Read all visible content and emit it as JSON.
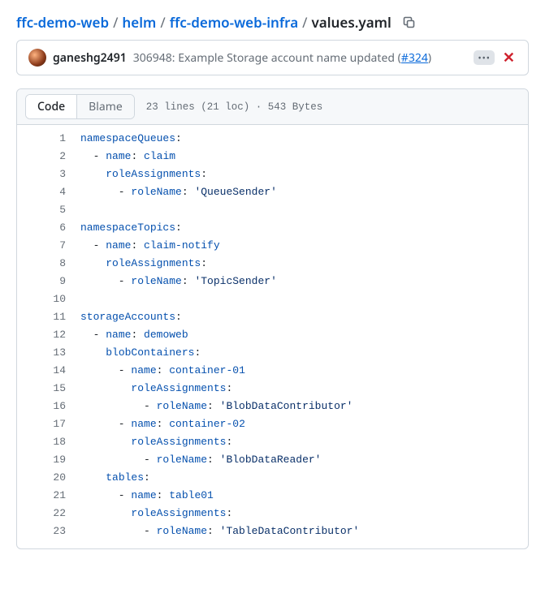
{
  "breadcrumbs": {
    "parts": [
      "ffc-demo-web",
      "helm",
      "ffc-demo-web-infra"
    ],
    "leaf": "values.yaml"
  },
  "commit": {
    "author": "ganeshg2491",
    "sha_prefix": "306948",
    "message": "Example Storage account name updated",
    "pr": "#324",
    "menu_glyph": "•••",
    "close_glyph": "✕"
  },
  "toolbar": {
    "code_label": "Code",
    "blame_label": "Blame",
    "meta": "23 lines (21 loc) · 543 Bytes"
  },
  "file": {
    "line_count": 23,
    "lines": [
      [
        [
          "k",
          "namespaceQueues"
        ],
        [
          "p",
          ":"
        ]
      ],
      [
        [
          "p",
          "  - "
        ],
        [
          "k",
          "name"
        ],
        [
          "p",
          ": "
        ],
        [
          "sc",
          "claim"
        ]
      ],
      [
        [
          "p",
          "    "
        ],
        [
          "k",
          "roleAssignments"
        ],
        [
          "p",
          ":"
        ]
      ],
      [
        [
          "p",
          "      - "
        ],
        [
          "k",
          "roleName"
        ],
        [
          "p",
          ": "
        ],
        [
          "s",
          "'QueueSender'"
        ]
      ],
      [],
      [
        [
          "k",
          "namespaceTopics"
        ],
        [
          "p",
          ":"
        ]
      ],
      [
        [
          "p",
          "  - "
        ],
        [
          "k",
          "name"
        ],
        [
          "p",
          ": "
        ],
        [
          "sc",
          "claim-notify"
        ]
      ],
      [
        [
          "p",
          "    "
        ],
        [
          "k",
          "roleAssignments"
        ],
        [
          "p",
          ":"
        ]
      ],
      [
        [
          "p",
          "      - "
        ],
        [
          "k",
          "roleName"
        ],
        [
          "p",
          ": "
        ],
        [
          "s",
          "'TopicSender'"
        ]
      ],
      [],
      [
        [
          "k",
          "storageAccounts"
        ],
        [
          "p",
          ":"
        ]
      ],
      [
        [
          "p",
          "  - "
        ],
        [
          "k",
          "name"
        ],
        [
          "p",
          ": "
        ],
        [
          "sc",
          "demoweb"
        ]
      ],
      [
        [
          "p",
          "    "
        ],
        [
          "k",
          "blobContainers"
        ],
        [
          "p",
          ":"
        ]
      ],
      [
        [
          "p",
          "      - "
        ],
        [
          "k",
          "name"
        ],
        [
          "p",
          ": "
        ],
        [
          "sc",
          "container-01"
        ]
      ],
      [
        [
          "p",
          "        "
        ],
        [
          "k",
          "roleAssignments"
        ],
        [
          "p",
          ":"
        ]
      ],
      [
        [
          "p",
          "          - "
        ],
        [
          "k",
          "roleName"
        ],
        [
          "p",
          ": "
        ],
        [
          "s",
          "'BlobDataContributor'"
        ]
      ],
      [
        [
          "p",
          "      - "
        ],
        [
          "k",
          "name"
        ],
        [
          "p",
          ": "
        ],
        [
          "sc",
          "container-02"
        ]
      ],
      [
        [
          "p",
          "        "
        ],
        [
          "k",
          "roleAssignments"
        ],
        [
          "p",
          ":"
        ]
      ],
      [
        [
          "p",
          "          - "
        ],
        [
          "k",
          "roleName"
        ],
        [
          "p",
          ": "
        ],
        [
          "s",
          "'BlobDataReader'"
        ]
      ],
      [
        [
          "p",
          "    "
        ],
        [
          "k",
          "tables"
        ],
        [
          "p",
          ":"
        ]
      ],
      [
        [
          "p",
          "      - "
        ],
        [
          "k",
          "name"
        ],
        [
          "p",
          ": "
        ],
        [
          "sc",
          "table01"
        ]
      ],
      [
        [
          "p",
          "        "
        ],
        [
          "k",
          "roleAssignments"
        ],
        [
          "p",
          ":"
        ]
      ],
      [
        [
          "p",
          "          - "
        ],
        [
          "k",
          "roleName"
        ],
        [
          "p",
          ": "
        ],
        [
          "s",
          "'TableDataContributor'"
        ]
      ]
    ]
  }
}
